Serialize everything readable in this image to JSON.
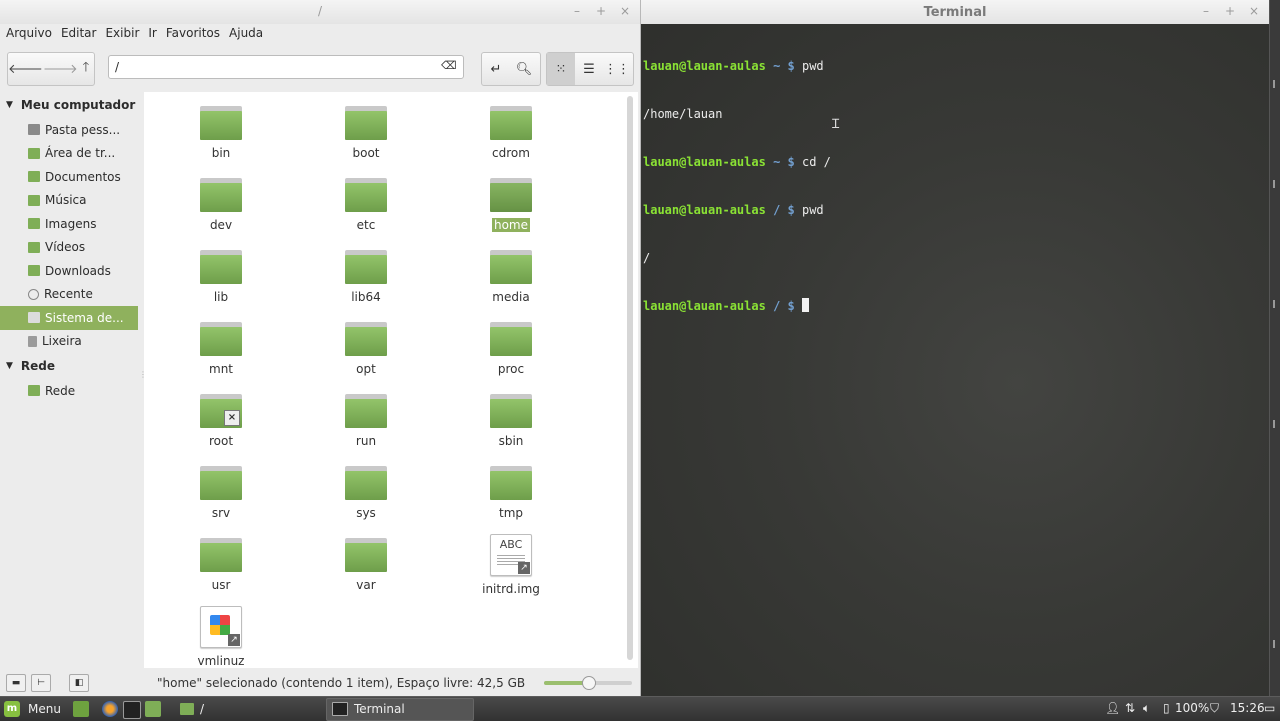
{
  "file_manager": {
    "title": "/",
    "menu": [
      "Arquivo",
      "Editar",
      "Exibir",
      "Ir",
      "Favoritos",
      "Ajuda"
    ],
    "path": "/",
    "sidebar": {
      "sections": [
        {
          "label": "Meu computador",
          "items": [
            {
              "label": "Pasta pess...",
              "icon": "home-folder-icon"
            },
            {
              "label": "Área de tr...",
              "icon": "desktop-icon"
            },
            {
              "label": "Documentos",
              "icon": "documents-folder-icon"
            },
            {
              "label": "Música",
              "icon": "music-folder-icon"
            },
            {
              "label": "Imagens",
              "icon": "pictures-folder-icon"
            },
            {
              "label": "Vídeos",
              "icon": "videos-folder-icon"
            },
            {
              "label": "Downloads",
              "icon": "downloads-folder-icon"
            },
            {
              "label": "Recente",
              "icon": "recent-icon"
            },
            {
              "label": "Sistema de...",
              "icon": "filesystem-icon",
              "selected": true
            },
            {
              "label": "Lixeira",
              "icon": "trash-icon"
            }
          ]
        },
        {
          "label": "Rede",
          "items": [
            {
              "label": "Rede",
              "icon": "network-icon"
            }
          ]
        }
      ]
    },
    "files": [
      {
        "name": "bin",
        "type": "folder"
      },
      {
        "name": "boot",
        "type": "folder"
      },
      {
        "name": "cdrom",
        "type": "folder"
      },
      {
        "name": "dev",
        "type": "folder"
      },
      {
        "name": "etc",
        "type": "folder"
      },
      {
        "name": "home",
        "type": "folder",
        "selected": true
      },
      {
        "name": "lib",
        "type": "folder"
      },
      {
        "name": "lib64",
        "type": "folder"
      },
      {
        "name": "media",
        "type": "folder"
      },
      {
        "name": "mnt",
        "type": "folder"
      },
      {
        "name": "opt",
        "type": "folder"
      },
      {
        "name": "proc",
        "type": "folder"
      },
      {
        "name": "root",
        "type": "folder-locked"
      },
      {
        "name": "run",
        "type": "folder"
      },
      {
        "name": "sbin",
        "type": "folder"
      },
      {
        "name": "srv",
        "type": "folder"
      },
      {
        "name": "sys",
        "type": "folder"
      },
      {
        "name": "tmp",
        "type": "folder"
      },
      {
        "name": "usr",
        "type": "folder"
      },
      {
        "name": "var",
        "type": "folder"
      },
      {
        "name": "initrd.img",
        "type": "text-link",
        "icon_text": "ABC"
      },
      {
        "name": "vmlinuz",
        "type": "binary-link"
      }
    ],
    "status": "\"home\" selecionado (contendo 1 item), Espaço livre: 42,5 GB",
    "zoom_level": 0.5
  },
  "terminal": {
    "title": "Terminal",
    "lines": [
      {
        "user": "lauan@lauan-aulas",
        "dir": "~",
        "cmd": "pwd"
      },
      {
        "output": "/home/lauan"
      },
      {
        "user": "lauan@lauan-aulas",
        "dir": "~",
        "cmd": "cd /"
      },
      {
        "user": "lauan@lauan-aulas",
        "dir": "/",
        "cmd": "pwd"
      },
      {
        "output": "/"
      },
      {
        "user": "lauan@lauan-aulas",
        "dir": "/",
        "cmd": "",
        "cursor": true
      }
    ]
  },
  "taskbar": {
    "menu_label": "Menu",
    "tasks": [
      {
        "label": "/",
        "icon": "folder-icon"
      },
      {
        "label": "Terminal",
        "icon": "terminal-icon",
        "active": true
      }
    ],
    "battery": "100%",
    "clock": "15:26"
  },
  "colors": {
    "accent": "#8fb15d",
    "folder": "#7fae57",
    "prompt_user": "#8ae234",
    "prompt_dir": "#729fcf"
  }
}
